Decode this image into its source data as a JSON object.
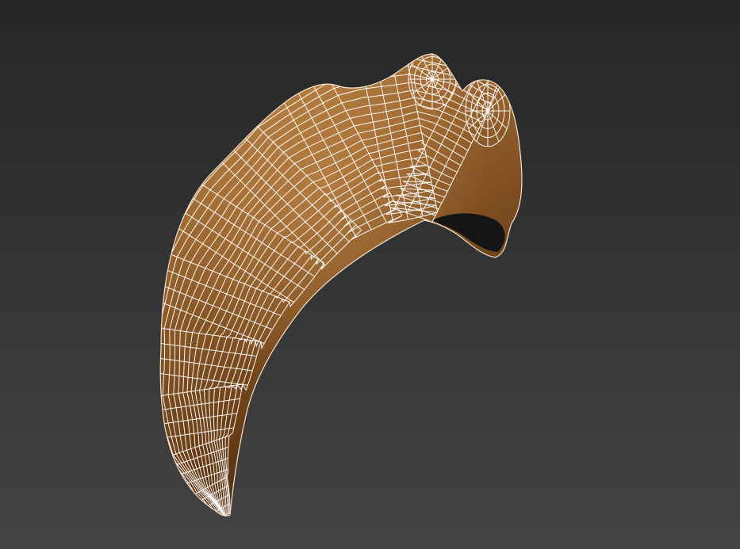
{
  "viewport": {
    "background_top": "#262626",
    "background_bottom": "#444444"
  },
  "model": {
    "object": "claw",
    "display_mode": "shaded-with-wireframe",
    "surface_color": "#8a5a28",
    "surface_highlight": "#b8823e",
    "surface_shadow": "#3a1d08",
    "wire_color": "#ffffff",
    "interior_color": "#151515"
  }
}
